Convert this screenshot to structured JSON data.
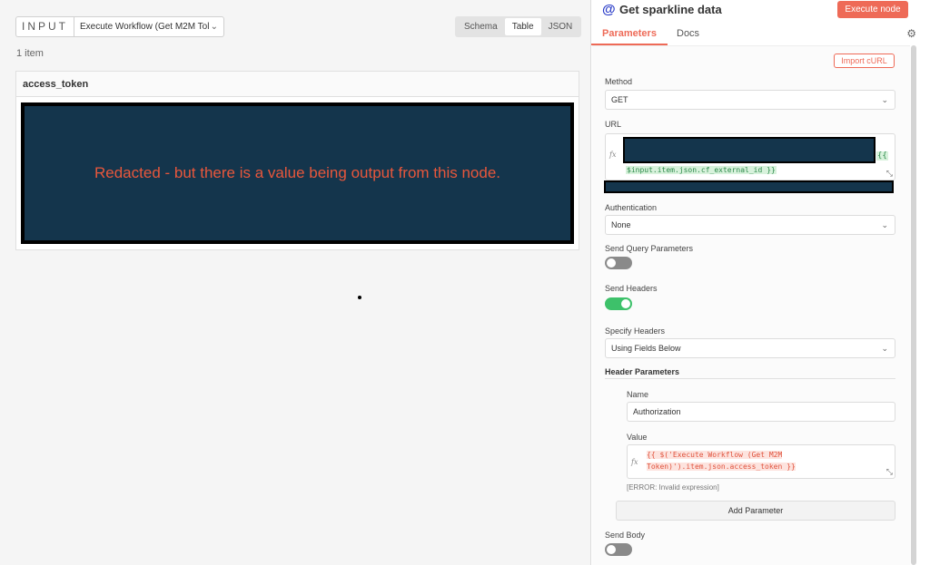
{
  "input_panel": {
    "label": "INPUT",
    "source_select": "Execute Workflow (Get M2M Tol",
    "view_tabs": [
      "Schema",
      "Table",
      "JSON"
    ],
    "active_view": "Table",
    "item_count": "1 item",
    "column_header": "access_token",
    "redacted_note": "Redacted - but there is a value being output from this node."
  },
  "node": {
    "icon": "at-icon",
    "title": "Get sparkline data",
    "execute_label": "Execute node",
    "tabs": [
      "Parameters",
      "Docs"
    ],
    "active_tab": "Parameters"
  },
  "params": {
    "import_curl": "Import cURL",
    "method_label": "Method",
    "method_value": "GET",
    "url_label": "URL",
    "url_expr_open": "{{",
    "url_expr_rest": "$input.item.json.cf_external_id }}",
    "auth_label": "Authentication",
    "auth_value": "None",
    "send_query_label": "Send Query Parameters",
    "send_query_on": false,
    "send_headers_label": "Send Headers",
    "send_headers_on": true,
    "specify_headers_label": "Specify Headers",
    "specify_headers_value": "Using Fields Below",
    "header_params_title": "Header Parameters",
    "name_label": "Name",
    "name_value": "Authorization",
    "value_label": "Value",
    "value_line1": "{{ $('Execute Workflow (Get M2M ",
    "value_line2": "Token)').item.json.access_token }}",
    "error_text": "[ERROR: Invalid expression]",
    "add_parameter": "Add Parameter",
    "send_body_label": "Send Body",
    "send_body_on": false
  },
  "colors": {
    "accent": "#ee6a57",
    "toggle_on": "#3dc16a",
    "redaction": "#14354c"
  }
}
